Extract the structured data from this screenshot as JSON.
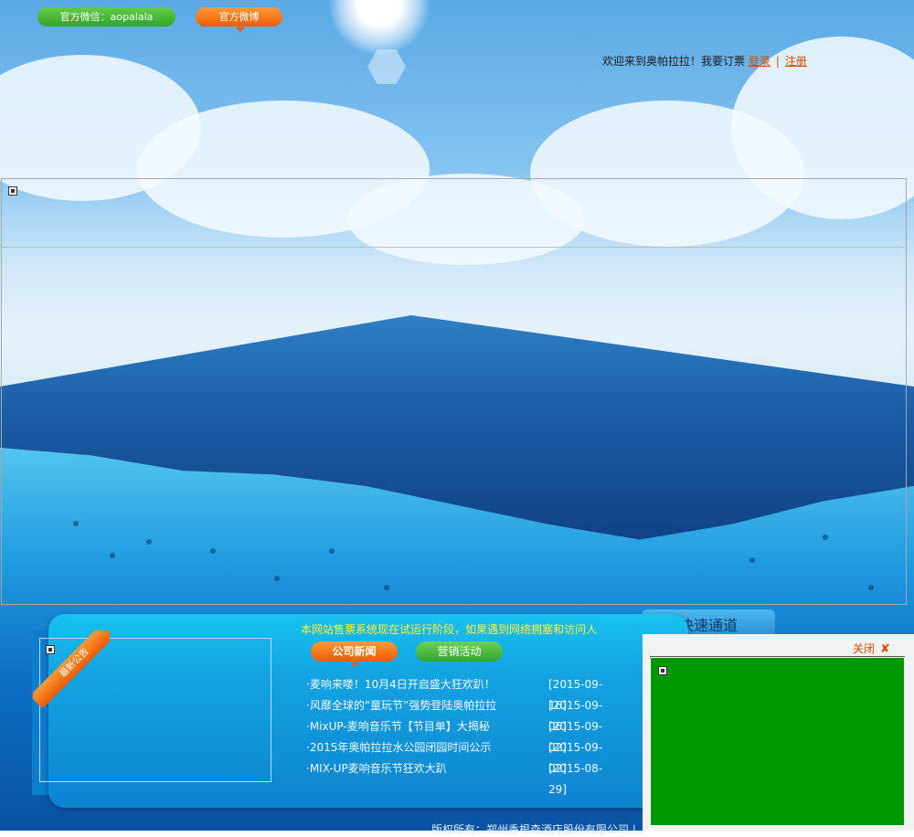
{
  "header": {
    "wechat_label": "官方微信：aopalala",
    "weibo_label": "官方微博"
  },
  "welcome": {
    "text": "欢迎来到奥帕拉拉！我要订票",
    "login_label": "登录",
    "separator": "|",
    "register_label": "注册"
  },
  "quick_tab": {
    "label": "快速通道"
  },
  "notice": {
    "ribbon_label": "最新公告",
    "marquee_text": "本网站售票系统现在试运行阶段，如果遇到网络拥塞和访问人"
  },
  "tabs": {
    "news_label": "公司新闻",
    "promo_label": "营销活动"
  },
  "news": [
    {
      "title": "·麦响来喽！10月4日开启盛大狂欢趴！",
      "date": "[2015-09-16]"
    },
    {
      "title": "·风靡全球的“童玩节”强势登陆奥帕拉拉",
      "date": "[2015-09-06]"
    },
    {
      "title": "·MixUP-麦响音乐节【节目单】大揭秘",
      "date": "[2015-09-02]"
    },
    {
      "title": "·2015年奥帕拉拉水公园闭园时间公示",
      "date": "[2015-09-02]"
    },
    {
      "title": "·MIX-UP麦响音乐节狂欢大趴",
      "date": "[2015-08-29]"
    }
  ],
  "footer": {
    "text": "版权所有：郑州香根森酒店股份有限公司 |"
  },
  "float_window": {
    "close_label": "关闭",
    "close_icon": "x-icon"
  },
  "colors": {
    "accent_orange": "#ef5a00",
    "accent_green": "#33a62a",
    "link_orange": "#d24b00",
    "marquee_yellow": "#ffef3a",
    "promo_green_box": "#009800"
  }
}
